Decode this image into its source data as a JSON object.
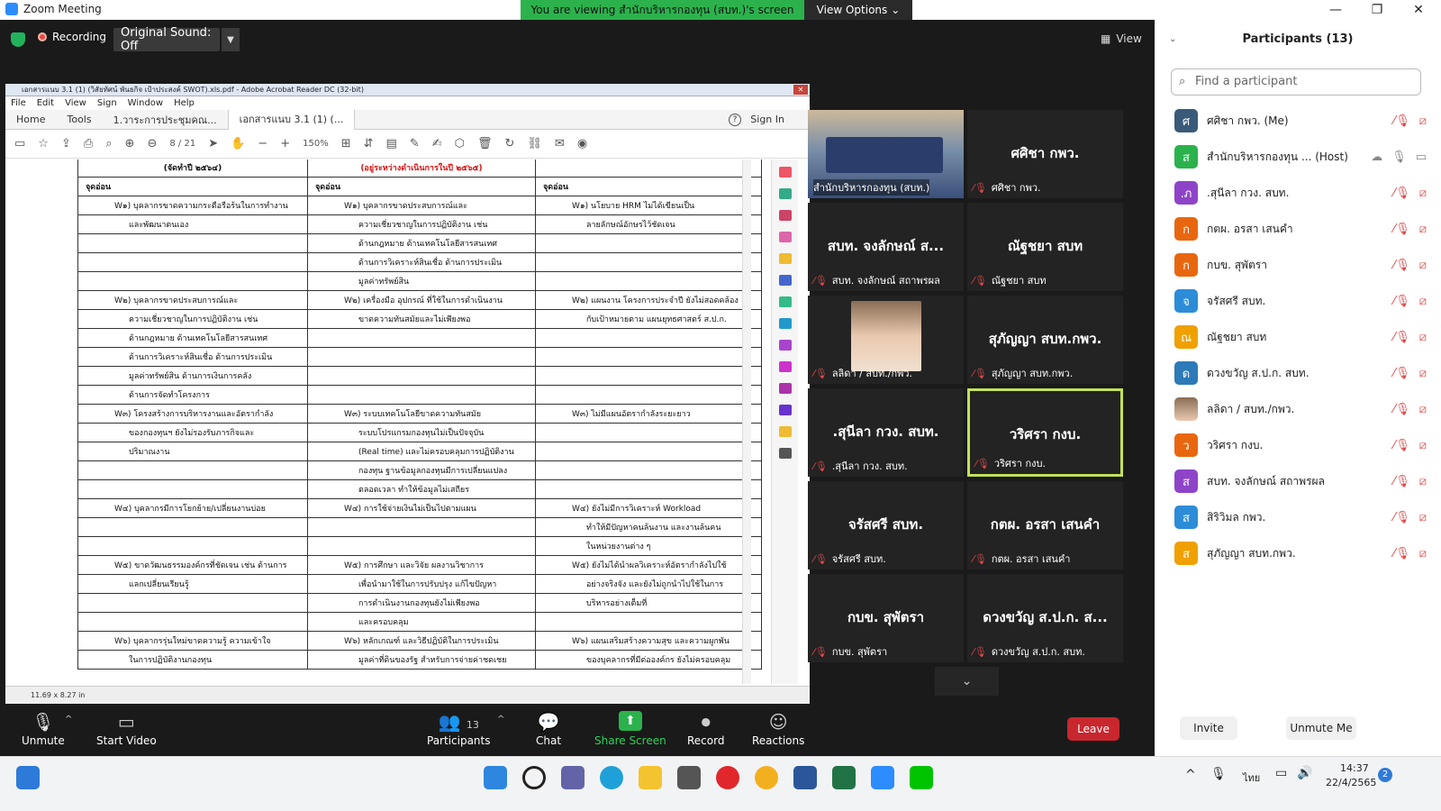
{
  "window": {
    "title": "Zoom Meeting",
    "viewing_banner": "You are viewing สำนักบริหารกองทุน (สบท.)'s screen",
    "view_options": "View Options",
    "min": "—",
    "max": "❐",
    "close": "✕"
  },
  "topbar": {
    "recording": "Recording",
    "original_sound": "Original Sound: Off",
    "view": "View"
  },
  "acrobat": {
    "title": "เอกสารแนบ 3.1 (1) (วิสัยทัศน์ พันธกิจ เป้าประสงค์ SWOT).xls.pdf - Adobe Acrobat Reader DC (32-bit)",
    "menu": [
      "File",
      "Edit",
      "View",
      "Sign",
      "Window",
      "Help"
    ],
    "tabs": [
      "Home",
      "Tools",
      "1.วาระการประชุมคณ...",
      "เอกสารแนบ 3.1 (1) (..."
    ],
    "sign_in": "Sign In",
    "page": "8",
    "page_total": "/ 21",
    "zoom": "150%",
    "page_size": "11.69 x 8.27 in",
    "table_head": [
      "(จัดทำปี ๒๕๖๔)",
      "(อยู่ระหว่างดำเนินการในปี ๒๕๖๕)",
      ""
    ],
    "table_sub": [
      "จุดอ่อน",
      "จุดอ่อน",
      "จุดอ่อน"
    ],
    "rows": [
      [
        "W๑) บุคลากรขาดความกระตือรือร้นในการทำงาน",
        "W๑) บุคลากรขาดประสบการณ์และ",
        "W๑) นโยบาย HRM ไม่ได้เขียนเป็น"
      ],
      [
        "และพัฒนาตนเอง",
        "ความเชี่ยวชาญในการปฏิบัติงาน เช่น",
        "ลายลักษณ์อักษรไว้ชัดเจน"
      ],
      [
        "",
        "ด้านกฎหมาย ด้านเทคโนโลยีสารสนเทศ",
        ""
      ],
      [
        "",
        "ด้านการวิเคราะห์สินเชื่อ ด้านการประเมิน",
        ""
      ],
      [
        "",
        "มูลค่าทรัพย์สิน",
        ""
      ],
      [
        "W๒) บุคลากรขาดประสบการณ์และ",
        "W๒) เครื่องมือ อุปกรณ์ ที่ใช้ในการดำเนินงาน",
        "W๒) แผนงาน โครงการประจำปี ยังไม่สอดคล้อง"
      ],
      [
        "ความเชี่ยวชาญในการปฏิบัติงาน เช่น",
        "ขาดความทันสมัยและไม่เพียงพอ",
        "กับเป้าหมายตาม แผนยุทธศาสตร์ ส.ป.ก."
      ],
      [
        "ด้านกฎหมาย ด้านเทคโนโลยีสารสนเทศ",
        "",
        ""
      ],
      [
        "ด้านการวิเคราะห์สินเชื่อ ด้านการประเมิน",
        "",
        ""
      ],
      [
        "มูลค่าทรัพย์สิน ด้านการเงินการคลัง",
        "",
        ""
      ],
      [
        "ด้านการจัดทำโครงการ",
        "",
        ""
      ],
      [
        "W๓) โครงสร้างการบริหารงานและอัตรากำลัง",
        "W๓) ระบบเทคโนโลยีขาดความทันสมัย",
        "W๓) ไม่มีแผนอัตรากำลังระยะยาว"
      ],
      [
        "ของกองทุนฯ ยังไม่รองรับภารกิจและ",
        "ระบบโปรแกรมกองทุนไม่เป็นปัจจุบัน",
        ""
      ],
      [
        "ปริมาณงาน",
        "(Real time) และไม่ครอบคลุมการปฏิบัติงาน",
        ""
      ],
      [
        "",
        "กองทุน ฐานข้อมูลกองทุนมีการเปลี่ยนแปลง",
        ""
      ],
      [
        "",
        "ตลอดเวลา ทำให้ข้อมูลไม่เสถียร",
        ""
      ],
      [
        "W๔) บุคลากรมีการโยกย้าย/เปลี่ยนงานบ่อย",
        "W๔) การใช้จ่ายเงินไม่เป็นไปตามแผน",
        "W๔) ยังไม่มีการวิเคราะห์ Workload"
      ],
      [
        "",
        "",
        "ทำให้มีปัญหาคนล้นงาน และงานล้นคน"
      ],
      [
        "",
        "",
        "ในหน่วยงานต่าง ๆ"
      ],
      [
        "W๕) ขาดวัฒนธรรมองค์กรที่ชัดเจน เช่น ด้านการ",
        "W๕) การศึกษา และวิจัย ผลงานวิชาการ",
        "W๕) ยังไม่ได้นำผลวิเคราะห์อัตรากำลังไปใช้"
      ],
      [
        "แลกเปลี่ยนเรียนรู้",
        "เพื่อนำมาใช้ในการปรับปรุง แก้ไขปัญหา",
        "อย่างจริงจัง และยังไม่ถูกนำไปใช้ในการ"
      ],
      [
        "",
        "การดำเนินงานกองทุนยังไม่เพียงพอ",
        "บริหารอย่างเต็มที่"
      ],
      [
        "",
        "และครอบคลุม",
        ""
      ],
      [
        "W๖) บุคลากรรุ่นใหม่ขาดความรู้ ความเข้าใจ",
        "W๖) หลักเกณฑ์ และวิธีปฏิบัติในการประเมิน",
        "W๖) แผนเสริมสร้างความสุข และความผูกพัน"
      ],
      [
        "ในการปฏิบัติงานกองทุน",
        "มูลค่าที่ดินของรัฐ สำหรับการจ่ายค่าชดเชย",
        "ของบุคลากรที่มีต่อองค์กร ยังไม่ครอบคลุม"
      ]
    ]
  },
  "tiles": [
    {
      "big": "",
      "name": "สำนักบริหารกองทุน (สบท.)",
      "video": true
    },
    {
      "big": "ศศิชา กพว.",
      "name": "ศศิชา กพว."
    },
    {
      "big": "สบท. จงลักษณ์ ส...",
      "name": "สบท. จงลักษณ์ สถาพรผล"
    },
    {
      "big": "ณัฐชยา สบท",
      "name": "ณัฐชยา สบท"
    },
    {
      "big": "",
      "name": "ลลิดา / สบท./กพว.",
      "photo": true
    },
    {
      "big": "สุภัญญา สบท.กพว.",
      "name": "สุภัญญา สบท.กพว."
    },
    {
      "big": ".สุนีลา กวง. สบท.",
      "name": ".สุนีลา กวง. สบท."
    },
    {
      "big": "วริศรา กงบ.",
      "name": "วริศรา กงบ.",
      "active": true
    },
    {
      "big": "จรัสศรี สบท.",
      "name": "จรัสศรี สบท."
    },
    {
      "big": "กตผ. อรสา เสนคำ",
      "name": "กตผ. อรสา เสนคำ"
    },
    {
      "big": "กบข. สุพัตรา",
      "name": "กบข. สุพัตรา"
    },
    {
      "big": "ดวงขวัญ ส.ป.ก. ส...",
      "name": "ดวงขวัญ ส.ป.ก. สบท."
    }
  ],
  "toolbar": {
    "unmute": "Unmute",
    "start_video": "Start Video",
    "participants": "Participants",
    "participants_count": "13",
    "chat": "Chat",
    "share_screen": "Share Screen",
    "record": "Record",
    "reactions": "Reactions",
    "leave": "Leave"
  },
  "panel": {
    "title": "Participants (13)",
    "search_placeholder": "Find a participant",
    "invite": "Invite",
    "unmute_me": "Unmute Me",
    "participants": [
      {
        "initial": "ศ",
        "name": "ศศิชา กพว. (Me)",
        "color": "#3a5a7a",
        "video": false
      },
      {
        "initial": "ส",
        "name": "สำนักบริหารกองทุน ... (Host)",
        "color": "#2bb24c",
        "video": true
      },
      {
        "initial": ".ภ",
        "name": ".สุนีลา  กวง. สบท.",
        "color": "#8e44c8",
        "video": false
      },
      {
        "initial": "ก",
        "name": "กตผ. อรสา เสนคำ",
        "color": "#e8670e",
        "video": false
      },
      {
        "initial": "ก",
        "name": "กบข. สุพัตรา",
        "color": "#e8670e",
        "video": false
      },
      {
        "initial": "จ",
        "name": "จรัสศรี สบท.",
        "color": "#2d8cd8",
        "video": false
      },
      {
        "initial": "ณ",
        "name": "ณัฐชยา สบท",
        "color": "#f0a000",
        "video": false
      },
      {
        "initial": "ด",
        "name": "ดวงขวัญ ส.ป.ก. สบท.",
        "color": "#2d7ab8",
        "video": false
      },
      {
        "initial": "",
        "name": "ลลิดา / สบท./กพว.",
        "color": "#999999",
        "video": false
      },
      {
        "initial": "ว",
        "name": "วริศรา กงบ.",
        "color": "#e8670e",
        "video": false
      },
      {
        "initial": "ส",
        "name": "สบท. จงลักษณ์ สถาพรผล",
        "color": "#8e44c8",
        "video": false
      },
      {
        "initial": "ส",
        "name": "สิริวิมล กพว.",
        "color": "#2d8cd8",
        "video": false
      },
      {
        "initial": "ส",
        "name": "สุภัญญา สบท.กพว.",
        "color": "#f0a000",
        "video": false
      }
    ]
  },
  "taskbar": {
    "time": "14:37",
    "date": "22/4/2565",
    "lang": "ไทย",
    "notif": "2"
  }
}
